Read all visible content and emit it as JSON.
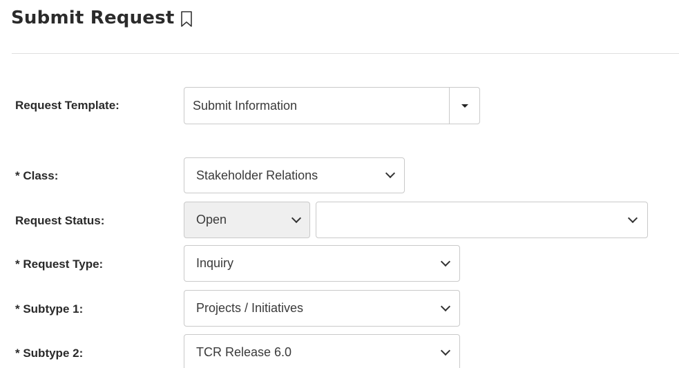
{
  "page": {
    "title": "Submit Request"
  },
  "form": {
    "request_template": {
      "label": "Request Template:",
      "value": "Submit Information"
    },
    "class": {
      "label": "* Class:",
      "value": "Stakeholder Relations"
    },
    "request_status": {
      "label": "Request Status:",
      "value": "Open",
      "secondary_value": ""
    },
    "request_type": {
      "label": "* Request Type:",
      "value": "Inquiry"
    },
    "subtype_1": {
      "label": "* Subtype 1:",
      "value": "Projects / Initiatives"
    },
    "subtype_2": {
      "label": "* Subtype 2:",
      "value": "TCR Release 6.0"
    }
  },
  "icons": {
    "bookmark": "bookmark-outline-icon",
    "dropdown": "chevron-down-icon",
    "caret": "caret-down-icon"
  }
}
